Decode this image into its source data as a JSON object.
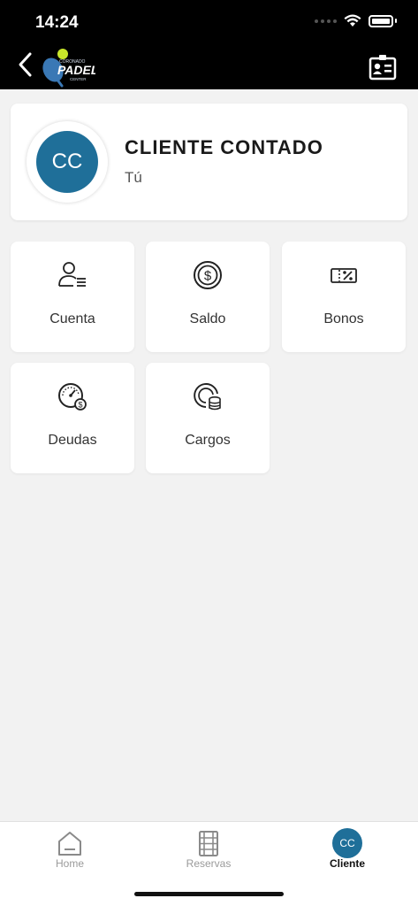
{
  "status_bar": {
    "time": "14:24"
  },
  "header": {
    "logo_text": "CORONADO PADEL CENTER"
  },
  "profile": {
    "initials": "CC",
    "name": "CLIENTE CONTADO",
    "subtitle": "Tú",
    "avatar_color": "#1f6f99"
  },
  "tiles": [
    {
      "label": "Cuenta",
      "icon": "user-list-icon"
    },
    {
      "label": "Saldo",
      "icon": "dollar-coin-icon"
    },
    {
      "label": "Bonos",
      "icon": "voucher-percent-icon"
    },
    {
      "label": "Deudas",
      "icon": "gauge-dollar-icon"
    },
    {
      "label": "Cargos",
      "icon": "coins-stack-icon"
    }
  ],
  "bottom_nav": {
    "items": [
      {
        "label": "Home",
        "icon": "home-icon"
      },
      {
        "label": "Reservas",
        "icon": "film-grid-icon"
      },
      {
        "label": "Cliente",
        "initials": "CC",
        "active": true
      }
    ]
  }
}
